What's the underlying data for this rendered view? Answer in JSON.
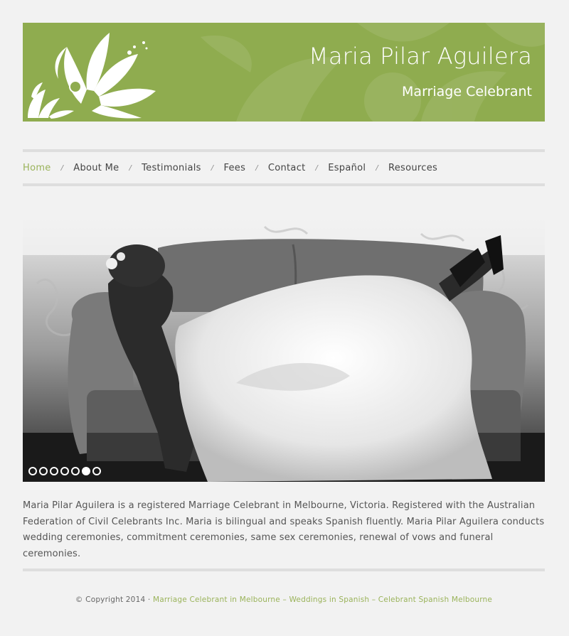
{
  "header": {
    "title": "Maria Pilar Aguilera",
    "subtitle": "Marriage Celebrant",
    "logo_icon": "lotus-flower-icon",
    "brand_color": "#8fac4f"
  },
  "nav": {
    "items": [
      {
        "label": "Home",
        "active": true
      },
      {
        "label": "About Me"
      },
      {
        "label": "Testimonials"
      },
      {
        "label": "Fees"
      },
      {
        "label": "Contact"
      },
      {
        "label": "Español"
      },
      {
        "label": "Resources"
      }
    ],
    "separator": "/",
    "active_color": "#9ab35a"
  },
  "slider": {
    "dots": 7,
    "active_dot": 6
  },
  "intro": {
    "text": "Maria Pilar Aguilera is a registered Marriage Celebrant in Melbourne, Victoria. Registered with the Australian Federation of Civil Celebrants Inc. Maria is bilingual and speaks Spanish fluently. Maria Pilar Aguilera conducts wedding ceremonies, commitment ceremonies, same sex ceremonies, renewal of vows and funeral ceremonies."
  },
  "footer": {
    "copyright": "© Copyright 2014 · ",
    "link_text": "Marriage Celebrant in Melbourne – Weddings in Spanish – Celebrant Spanish Melbourne"
  }
}
